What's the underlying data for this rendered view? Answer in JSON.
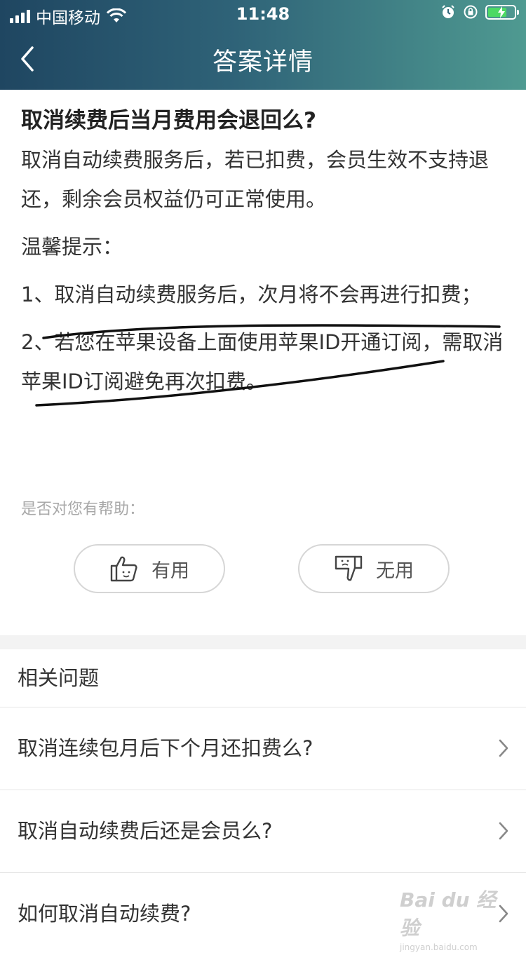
{
  "status_bar": {
    "carrier": "中国移动",
    "time": "11:48"
  },
  "nav": {
    "title": "答案详情"
  },
  "article": {
    "title": "取消续费后当月费用会退回么?",
    "paragraphs": [
      "取消自动续费服务后，若已扣费，会员生效不支持退还，剩余会员权益仍可正常使用。",
      "温馨提示：",
      "1、取消自动续费服务后，次月将不会再进行扣费；",
      "2、若您在苹果设备上面使用苹果ID开通订阅，需取消苹果ID订阅避免再次扣费。"
    ]
  },
  "feedback": {
    "prompt": "是否对您有帮助：",
    "useful_label": "有用",
    "useless_label": "无用"
  },
  "related": {
    "heading": "相关问题",
    "items": [
      "取消连续包月后下个月还扣费么?",
      "取消自动续费后还是会员么?",
      "如何取消自动续费?"
    ]
  },
  "watermark": {
    "brand": "Bai du 经验",
    "url": "jingyan.baidu.com"
  },
  "colors": {
    "header_start": "#1f4661",
    "header_end": "#4f9a91",
    "battery": "#4cd964"
  }
}
